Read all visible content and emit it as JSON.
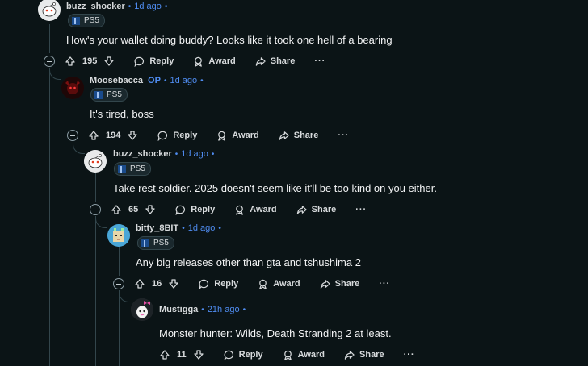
{
  "actions": {
    "reply": "Reply",
    "award": "Award",
    "share": "Share",
    "more": "···"
  },
  "comments": [
    {
      "user": "buzz_shocker",
      "op": "",
      "time": "1d ago",
      "flair": "PS5",
      "text": "How's your wallet doing buddy? Looks like it took one hell of a bearing",
      "score": "195",
      "avatar": "reddit-snoo"
    },
    {
      "user": "Moosebacca",
      "op": "OP",
      "time": "1d ago",
      "flair": "PS5",
      "text": "It's tired, boss",
      "score": "194",
      "avatar": "dark-red"
    },
    {
      "user": "buzz_shocker",
      "op": "",
      "time": "1d ago",
      "flair": "PS5",
      "text": "Take rest soldier. 2025 doesn't seem like it'll be too kind on you either.",
      "score": "65",
      "avatar": "reddit-snoo"
    },
    {
      "user": "bitty_8BIT",
      "op": "",
      "time": "1d ago",
      "flair": "PS5",
      "text": "Any big releases other than gta and tshushima 2",
      "score": "16",
      "avatar": "pixel-teal"
    },
    {
      "user": "Mustigga",
      "op": "",
      "time": "21h ago",
      "flair": "",
      "text": "Monster hunter: Wilds, Death Stranding 2 at least.",
      "score": "11",
      "avatar": "pink-bow"
    }
  ],
  "colors": {
    "background": "#0b1416",
    "accent": "#4f8cf0",
    "thread": "#33464c"
  }
}
